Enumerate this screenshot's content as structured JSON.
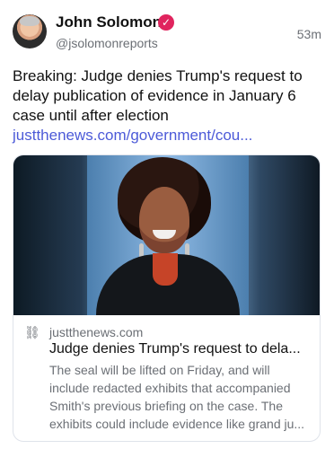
{
  "post": {
    "author_name": "John Solomon",
    "author_handle": "@jsolomonreports",
    "time": "53m",
    "text": "Breaking: Judge denies Trump's request to delay publication of evidence in January 6 case until after election",
    "link_text": "justthenews.com/government/cou..."
  },
  "card": {
    "domain": "justthenews.com",
    "title": "Judge denies Trump's request to dela...",
    "description": "The seal will be lifted on Friday, and will include redacted exhibits that accompanied Smith's previous briefing on the case. The exhibits could include evidence like grand ju..."
  },
  "colors": {
    "verified_badge": "#e0245e",
    "link": "#4c5ad8"
  }
}
